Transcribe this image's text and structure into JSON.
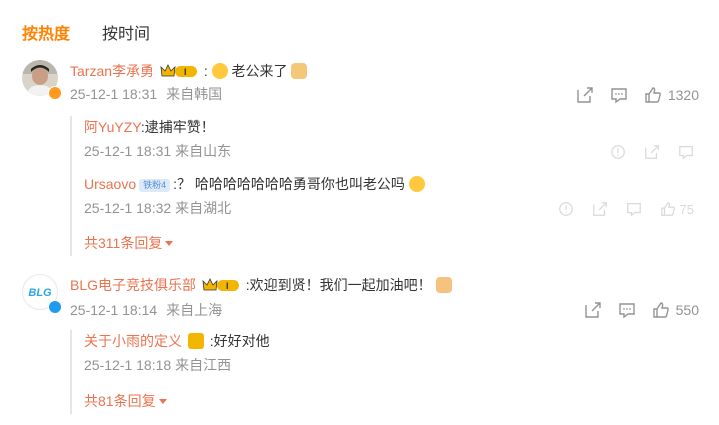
{
  "tabs": {
    "hot": "按热度",
    "time": "按时间"
  },
  "colors": {
    "accent": "#ff8200",
    "username": "#eb7350",
    "meta": "#939393"
  },
  "comments": [
    {
      "username": "Tarzan李承勇",
      "badge_icon": "crown-level-badge",
      "text_prefix": ":",
      "emoji1": "tongue-out-emoji",
      "text": "老公来了",
      "emoji2": "doge-emoji",
      "date": "25-12-1 18:31",
      "location": "来自韩国",
      "likes": "1320",
      "replies": [
        {
          "username": "阿YuYZY",
          "text": ":逮捕牢赞！",
          "date": "25-12-1 18:31",
          "location": "来自山东"
        },
        {
          "username": "Ursaovo",
          "tag": "铁粉4",
          "text": ":？ 哈哈哈哈哈哈哈勇哥你也叫老公吗",
          "emoji": "laughing-crying-emoji",
          "date": "25-12-1 18:32",
          "location": "来自湖北",
          "likes": "75"
        }
      ],
      "more_replies": "共311条回复"
    },
    {
      "username": "BLG电子竞技俱乐部",
      "badge_icon": "crown-level-badge",
      "text": ":欢迎到贤！我们一起加油吧！",
      "emoji": "flexed-biceps-emoji",
      "date": "25-12-1 18:14",
      "location": "来自上海",
      "likes": "550",
      "avatar_text": "BLG",
      "replies": [
        {
          "username": "关于小雨的定义",
          "badge_icon": "crown-emoji-badge",
          "text": ":好好对他",
          "date": "25-12-1 18:18",
          "location": "来自江西"
        }
      ],
      "more_replies": "共81条回复"
    }
  ]
}
